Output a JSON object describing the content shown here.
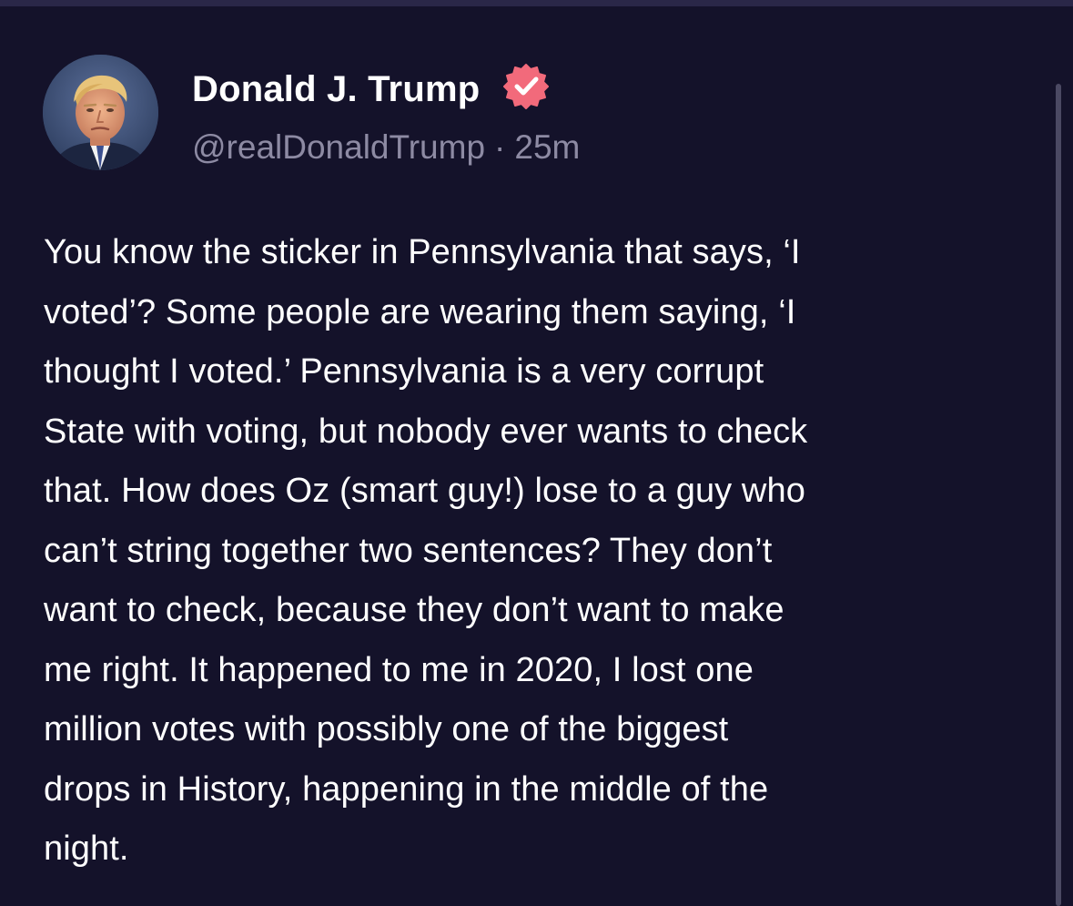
{
  "post": {
    "author": {
      "display_name": "Donald J. Trump",
      "handle": "@realDonaldTrump",
      "verified_icon": "verified-badge-icon",
      "avatar_icon": "profile-photo"
    },
    "separator": "·",
    "time_ago": "25m",
    "text": "You know the sticker in Pennsylvania that says, ‘I\nvoted’? Some people are wearing them saying, ‘I\nthought I voted.’ Pennsylvania is a very corrupt\nState with voting, but nobody ever wants to check\nthat. How does Oz (smart guy!) lose to a guy who\ncan’t string together two sentences? They don’t\nwant to check, because they don’t want to make\nme right. It happened to me in 2020, I lost one\nmillion votes with possibly one of the biggest\ndrops in History, happening in the middle of the\nnight."
  },
  "colors": {
    "background": "#14122a",
    "top_strip": "#2a2748",
    "text_primary": "#ffffff",
    "text_secondary": "#8d8aa3",
    "verified_badge": "#f26a7b",
    "scrollbar": "#4b4963"
  }
}
